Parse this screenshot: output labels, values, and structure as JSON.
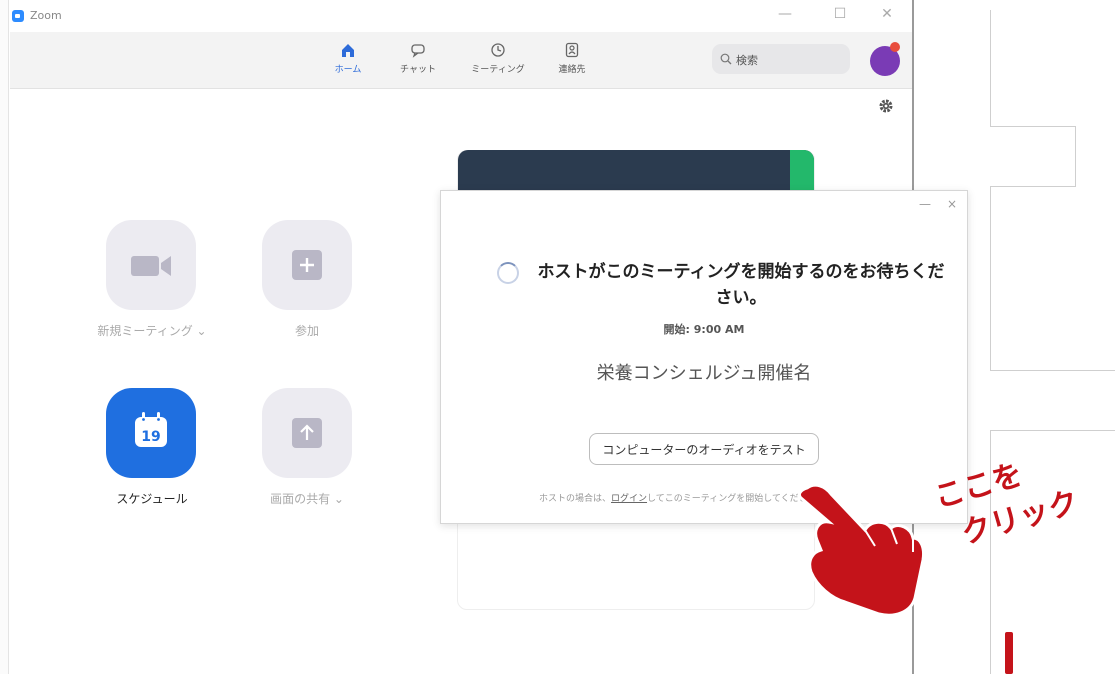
{
  "window": {
    "title": "Zoom",
    "controls": {
      "minimize": "—",
      "maximize": "☐",
      "close": "✕"
    }
  },
  "nav": {
    "items": [
      {
        "key": "home",
        "label": "ホーム"
      },
      {
        "key": "chat",
        "label": "チャット"
      },
      {
        "key": "meeting",
        "label": "ミーティング"
      },
      {
        "key": "contacts",
        "label": "連絡先"
      }
    ],
    "active": "home"
  },
  "search": {
    "placeholder": "検索"
  },
  "actions": {
    "new_meeting": "新規ミーティング ⌄",
    "join": "参加",
    "schedule": "スケジュール",
    "schedule_day": "19",
    "share_screen": "画面の共有 ⌄"
  },
  "dialog": {
    "controls": {
      "minimize": "—",
      "close": "×"
    },
    "wait_title": "ホストがこのミーティングを開始するのをお待ちください。",
    "start_time": "開始: 9:00 AM",
    "meeting_name": "栄養コンシェルジュ開催名",
    "test_audio_button": "コンピューターのオーディオをテスト",
    "host_note_prefix": "ホストの場合は、",
    "host_note_link": "ログイン",
    "host_note_suffix": "してこのミーティングを開始してください"
  },
  "annotation": {
    "line1": "ここを",
    "line2": "クリック"
  },
  "colors": {
    "accent": "#1f6fe0",
    "callout": "#c4131a",
    "avatar": "#7a3bb5"
  }
}
